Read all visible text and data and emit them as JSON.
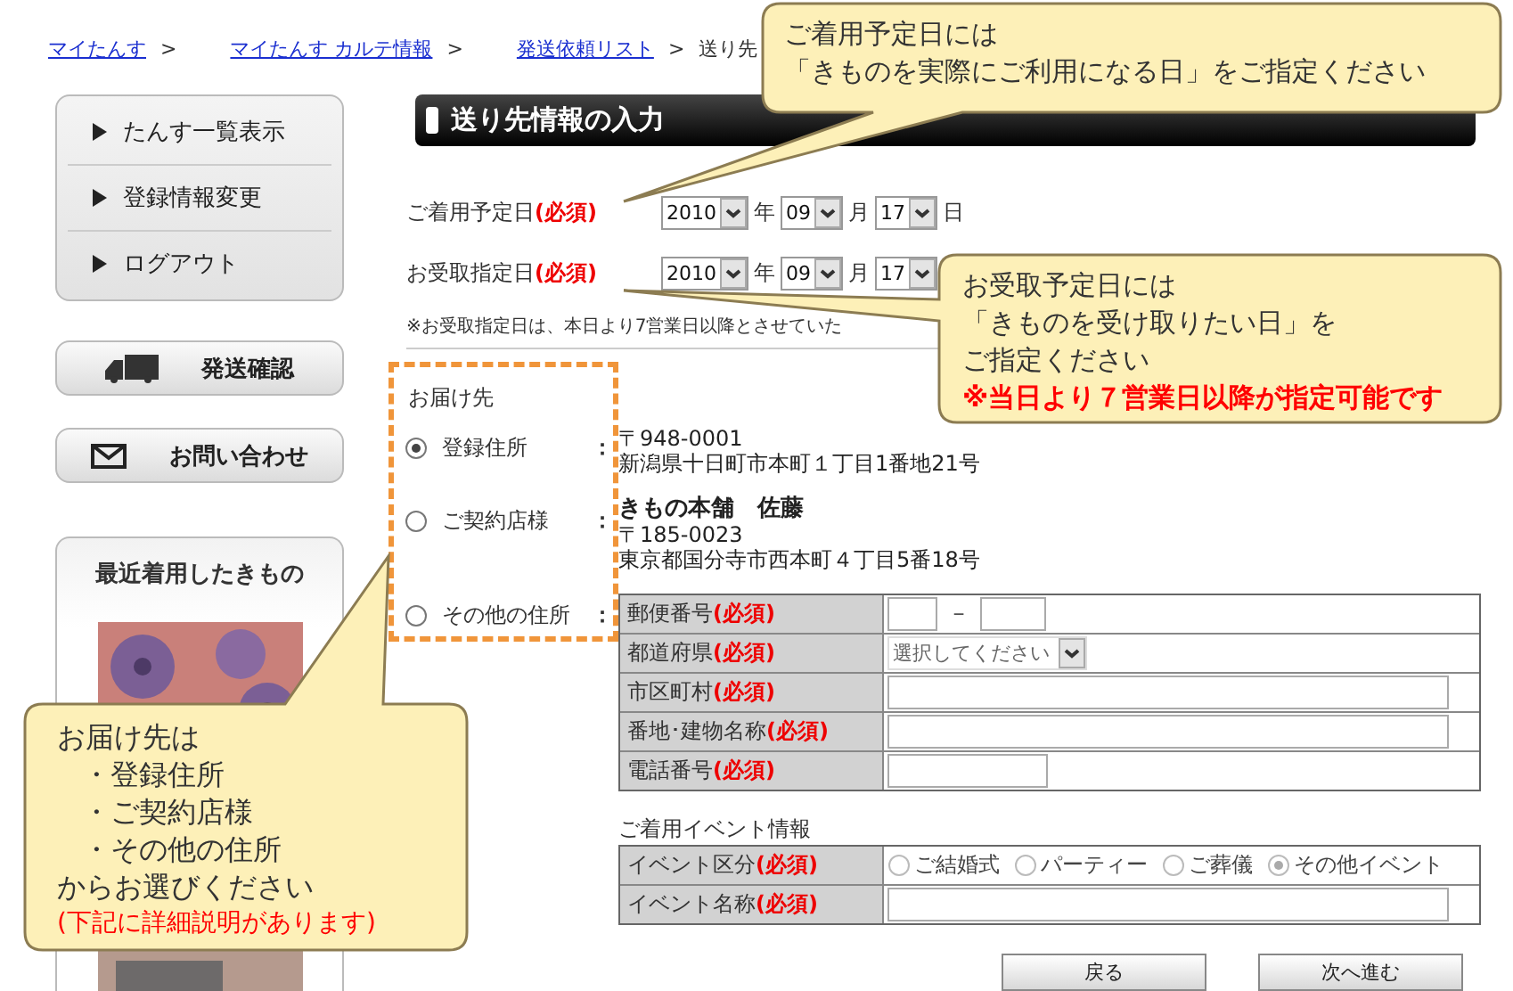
{
  "breadcrumb": [
    {
      "label": "マイたんす",
      "link": true,
      "separator": ">"
    },
    {
      "label": "マイたんす カルテ情報",
      "link": true,
      "separator": ">"
    },
    {
      "label": "発送依頼リスト",
      "link": true,
      "separator": ">"
    },
    {
      "label": "送り先",
      "link": false
    }
  ],
  "sidebar": {
    "menu": [
      "たんす一覧表示",
      "登録情報変更",
      "ログアウト"
    ],
    "buttons": [
      {
        "label": "発送確認"
      },
      {
        "label": "お問い合わせ"
      }
    ],
    "recent": {
      "title": "最近着用したきもの"
    }
  },
  "section_title": "送り先情報の入力",
  "dates": [
    {
      "label": "ご着用予定日",
      "required": "(必須)",
      "year": "2010",
      "year_unit": "年",
      "month": "09",
      "month_unit": "月",
      "day": "17",
      "day_unit": "日"
    },
    {
      "label": "お受取指定日",
      "required": "(必須)",
      "year": "2010",
      "year_unit": "年",
      "month": "09",
      "month_unit": "月",
      "day": "17"
    }
  ],
  "note": "※お受取指定日は、本日より7営業日以降とさせていた",
  "delivery": {
    "title": "お届け先",
    "options": [
      {
        "label": "登録住所",
        "colon": "：",
        "selected": true,
        "lines": [
          "〒948-0001",
          "新潟県十日町市本町１丁目1番地21号"
        ]
      },
      {
        "label": "ご契約店様",
        "colon": "：",
        "selected": false,
        "name": "きもの本舗　佐藤",
        "lines": [
          "〒185-0023",
          "東京都国分寺市西本町４丁目5番18号"
        ]
      },
      {
        "label": "その他の住所",
        "colon": "：",
        "selected": false
      }
    ]
  },
  "address_form": [
    {
      "label": "郵便番号",
      "required": "(必須)",
      "kind": "postal",
      "dash": "－"
    },
    {
      "label": "都道府県",
      "required": "(必須)",
      "kind": "select",
      "value": "選択してください"
    },
    {
      "label": "市区町村",
      "required": "(必須)",
      "kind": "text"
    },
    {
      "label": "番地･建物名称",
      "required": "(必須)",
      "kind": "text"
    },
    {
      "label": "電話番号",
      "required": "(必須)",
      "kind": "short"
    }
  ],
  "event": {
    "title": "ご着用イベント情報",
    "rows": [
      {
        "label": "イベント区分",
        "required": "(必須)",
        "kind": "radios",
        "options": [
          {
            "label": "ご結婚式",
            "selected": false
          },
          {
            "label": "パーティー",
            "selected": false
          },
          {
            "label": "ご葬儀",
            "selected": false
          },
          {
            "label": "その他イベント",
            "selected": true
          }
        ]
      },
      {
        "label": "イベント名称",
        "required": "(必須)",
        "kind": "text"
      }
    ]
  },
  "buttons": [
    "戻る",
    "次へ進む"
  ],
  "callouts": [
    {
      "kind": "top",
      "lines": [
        {
          "kind": "text",
          "text": "ご着用予定日には"
        },
        {
          "kind": "text",
          "text": "「きものを実際にご利用になる日」をご指定ください"
        }
      ]
    },
    {
      "kind": "right",
      "lines": [
        {
          "kind": "text",
          "text": "お受取予定日には"
        },
        {
          "kind": "text",
          "text": "「きものを受け取りたい日」を"
        },
        {
          "kind": "text",
          "text": "ご指定ください"
        },
        {
          "kind": "alert",
          "text": "※当日より７営業日以降が指定可能です"
        }
      ]
    },
    {
      "kind": "left",
      "lines": [
        {
          "kind": "text",
          "text": "お届け先は"
        },
        {
          "kind": "bullet",
          "text": "・登録住所"
        },
        {
          "kind": "bullet",
          "text": "・ご契約店様"
        },
        {
          "kind": "bullet",
          "text": "・その他の住所"
        },
        {
          "kind": "text",
          "text": "からお選びください"
        },
        {
          "kind": "notice",
          "text": "(下記に詳細説明があります)"
        }
      ]
    }
  ]
}
